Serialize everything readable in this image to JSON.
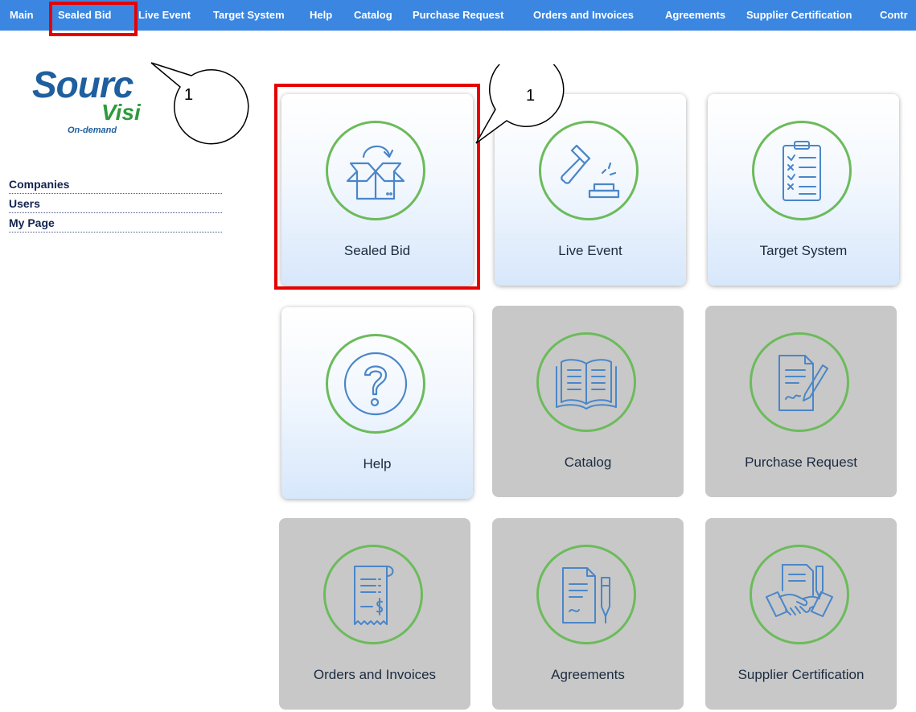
{
  "nav": {
    "items": [
      "Main",
      "Sealed Bid",
      "Live Event",
      "Target System",
      "Help",
      "Catalog",
      "Purchase Request",
      "Orders and Invoices",
      "Agreements",
      "Supplier Certification",
      "Contr"
    ]
  },
  "logo": {
    "line1": "Sourc",
    "line2": "Visi",
    "line3": "On-demand"
  },
  "sidebar": {
    "links": [
      "Companies",
      "Users",
      "My Page"
    ]
  },
  "tiles": [
    {
      "label": "Sealed Bid",
      "icon": "open-box-icon",
      "enabled": true
    },
    {
      "label": "Live Event",
      "icon": "gavel-icon",
      "enabled": true
    },
    {
      "label": "Target System",
      "icon": "checklist-clipboard-icon",
      "enabled": true
    },
    {
      "label": "Help",
      "icon": "question-mark-icon",
      "enabled": true
    },
    {
      "label": "Catalog",
      "icon": "open-book-icon",
      "enabled": false
    },
    {
      "label": "Purchase Request",
      "icon": "document-pen-icon",
      "enabled": false
    },
    {
      "label": "Orders and Invoices",
      "icon": "receipt-icon",
      "enabled": false
    },
    {
      "label": "Agreements",
      "icon": "contract-pen-icon",
      "enabled": false
    },
    {
      "label": "Supplier Certification",
      "icon": "handshake-icon",
      "enabled": false
    }
  ],
  "annotations": {
    "callout_1": "1",
    "callout_2": "1"
  },
  "colors": {
    "nav_bg": "#3b86e0",
    "icon_ring": "#6cbb5b",
    "icon_stroke": "#4a86c8",
    "highlight": "#e60000",
    "tile_disabled": "#c8c8c8"
  }
}
